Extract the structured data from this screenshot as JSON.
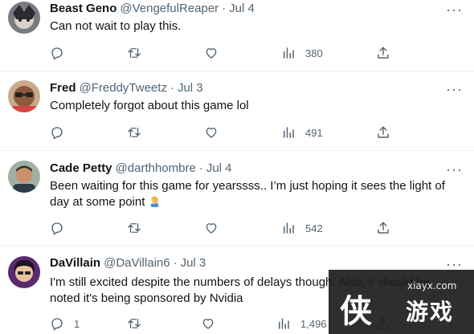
{
  "tweets": [
    {
      "name": "Beast Geno",
      "handle": "@VengefulReaper",
      "date": "Jul 4",
      "text": "Can not wait to play this.",
      "replies": "",
      "views": "380"
    },
    {
      "name": "Fred",
      "handle": "@FreddyTweetz",
      "date": "Jul 3",
      "text": "Completely forgot about this game lol",
      "replies": "",
      "views": "491"
    },
    {
      "name": "Cade Petty",
      "handle": "@darthhombre",
      "date": "Jul 4",
      "text": "Been waiting for this game for yearssss.. I’m just hoping it sees the light of day at some point",
      "replies": "",
      "views": "542"
    },
    {
      "name": "DaVillain",
      "handle": "@DaVillain6",
      "date": "Jul 3",
      "text": "I'm still excited despite the numbers of delays though. Also, it should be noted it's being sponsored by Nvidia",
      "replies": "1",
      "views": "1,496"
    }
  ],
  "separator": "·",
  "more_label": "···",
  "icons": {
    "reply": "reply-icon",
    "retweet": "retweet-icon",
    "like": "heart-icon",
    "views": "views-chart-icon",
    "share": "share-icon",
    "emoji": "person-facepalming-emoji"
  },
  "colors": {
    "text": "#0f1419",
    "secondary": "#536471",
    "divider": "#eff3f4"
  },
  "watermark": {
    "site": "xiayx.com",
    "glyph_main": "侠",
    "glyph_sub": "游戏"
  }
}
